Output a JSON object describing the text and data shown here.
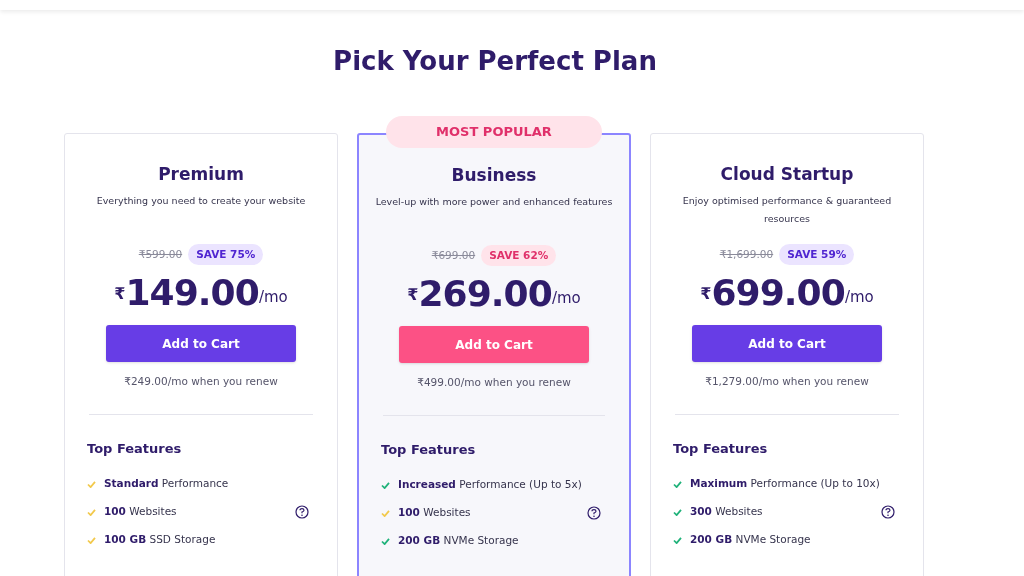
{
  "title": "Pick Your Perfect Plan",
  "plans": [
    {
      "name": "Premium",
      "featured": false,
      "description": "Everything you need to create your website",
      "old_price": "₹599.00",
      "save": "SAVE 75%",
      "currency": "₹",
      "amount": "149.00",
      "unit": "/mo",
      "button": "Add to Cart",
      "renew": "₹249.00/mo when you renew",
      "features_title": "Top Features",
      "features": [
        {
          "text": "**Standard** Performance",
          "color": "#f2c94c",
          "help": false
        },
        {
          "text": "**100** Websites",
          "color": "#f2c94c",
          "help": true
        },
        {
          "text": "**100 GB** SSD Storage",
          "color": "#f2c94c",
          "help": false
        }
      ]
    },
    {
      "name": "Business",
      "featured": true,
      "badge": "MOST POPULAR",
      "description": "Level-up with more power and enhanced features",
      "old_price": "₹699.00",
      "save": "SAVE 62%",
      "currency": "₹",
      "amount": "269.00",
      "unit": "/mo",
      "button": "Add to Cart",
      "renew": "₹499.00/mo when you renew",
      "features_title": "Top Features",
      "features": [
        {
          "text": "**Increased** Performance (Up to 5x)",
          "color": "#20b27a",
          "help": false
        },
        {
          "text": "**100** Websites",
          "color": "#f2c94c",
          "help": true
        },
        {
          "text": "**200 GB** NVMe Storage",
          "color": "#20b27a",
          "help": false
        }
      ]
    },
    {
      "name": "Cloud Startup",
      "featured": false,
      "description": "Enjoy optimised performance & guaranteed resources",
      "old_price": "₹1,699.00",
      "save": "SAVE 59%",
      "currency": "₹",
      "amount": "699.00",
      "unit": "/mo",
      "button": "Add to Cart",
      "renew": "₹1,279.00/mo when you renew",
      "features_title": "Top Features",
      "features": [
        {
          "text": "**Maximum** Performance (Up to 10x)",
          "color": "#20b27a",
          "help": false
        },
        {
          "text": "**300** Websites",
          "color": "#20b27a",
          "help": true
        },
        {
          "text": "**200 GB** NVMe Storage",
          "color": "#20b27a",
          "help": false
        }
      ]
    }
  ]
}
